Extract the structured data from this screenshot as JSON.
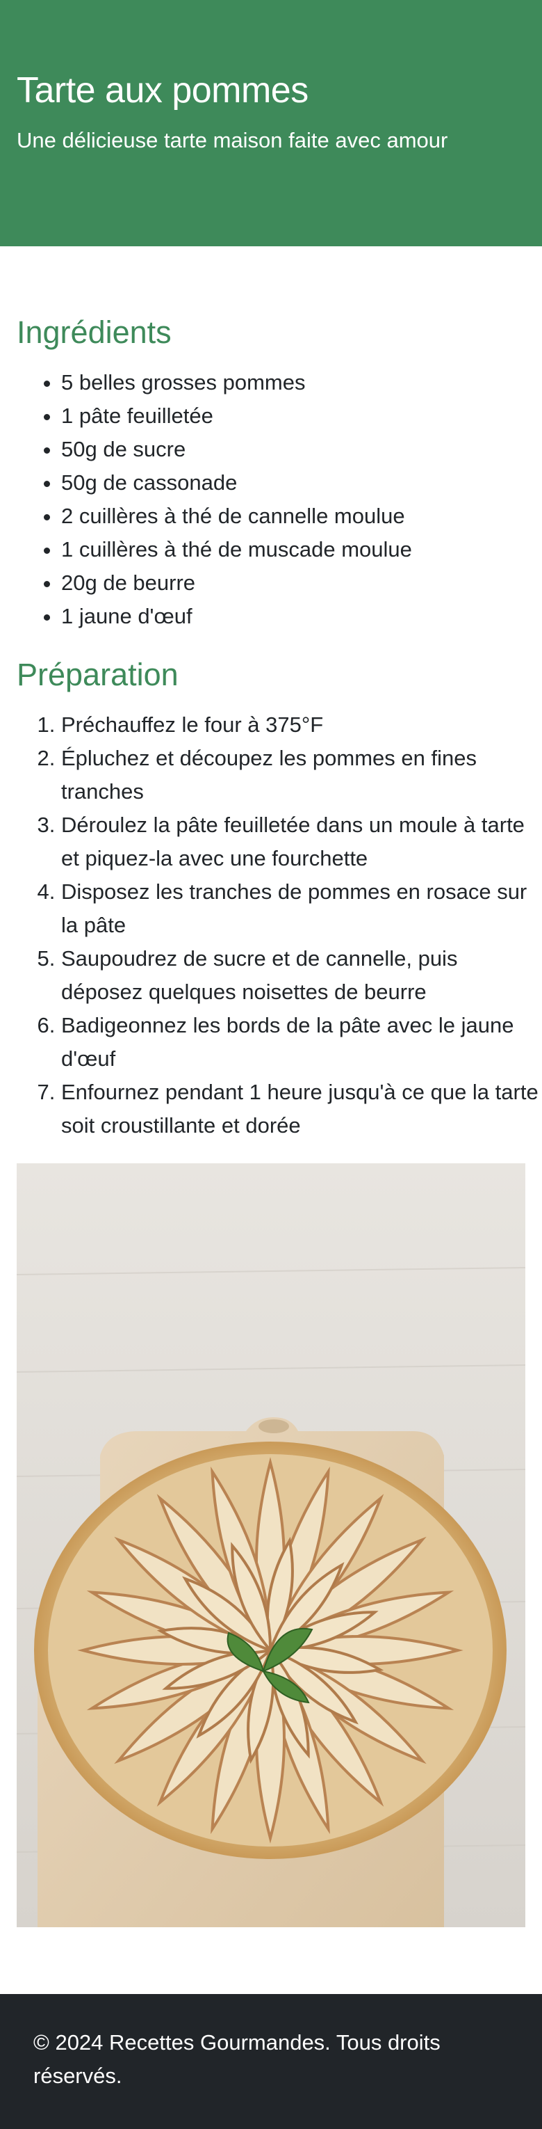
{
  "header": {
    "title": "Tarte aux pommes",
    "subtitle": "Une délicieuse tarte maison faite avec amour"
  },
  "ingredients": {
    "title": "Ingrédients",
    "items": [
      "5 belles grosses pommes",
      "1 pâte feuilletée",
      "50g de sucre",
      "50g de cassonade",
      "2 cuillères à thé de cannelle moulue",
      "1 cuillères à thé de muscade moulue",
      "20g de beurre",
      "1 jaune d'œuf"
    ]
  },
  "preparation": {
    "title": "Préparation",
    "steps": [
      "Préchauffez le four à 375°F",
      "Épluchez et découpez les pommes en fines tranches",
      "Déroulez la pâte feuilletée dans un moule à tarte et piquez-la avec une fourchette",
      "Disposez les tranches de pommes en rosace sur la pâte",
      "Saupoudrez de sucre et de cannelle, puis déposez quelques noisettes de beurre",
      "Badigeonnez les bords de la pâte avec le jaune d'œuf",
      "Enfournez pendant 1 heure jusqu'à ce que la tarte soit croustillante et dorée"
    ]
  },
  "footer": {
    "text": "© 2024 Recettes Gourmandes. Tous droits réservés."
  },
  "colors": {
    "header_bg": "#3e8a5a",
    "accent": "#3e8a5a",
    "footer_bg": "#212529",
    "text": "#212529"
  }
}
